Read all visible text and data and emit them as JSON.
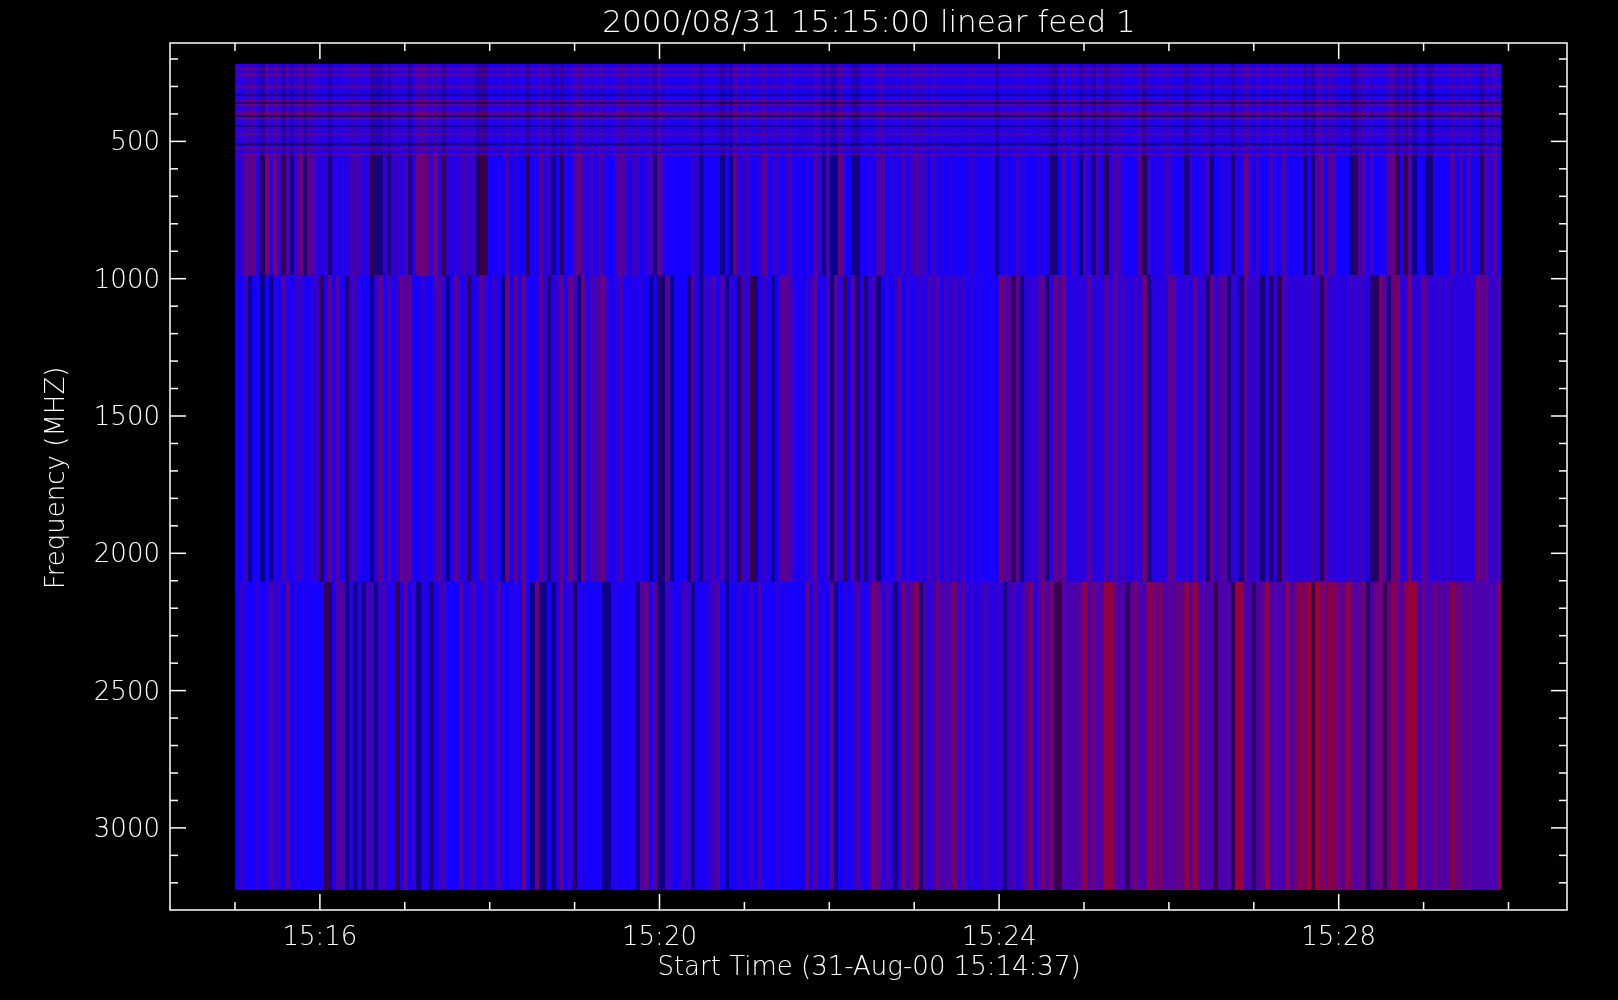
{
  "plot": {
    "title": "2000/08/31 15:15:00 linear feed 1",
    "x_axis": {
      "label": "Start Time (31-Aug-00 15:14:37)",
      "tick_labels": [
        "15:16",
        "15:20",
        "15:24",
        "15:28"
      ]
    },
    "y_axis": {
      "label": "Frequency (MHZ)",
      "tick_labels": [
        "500",
        "1000",
        "1500",
        "2000",
        "2500",
        "3000"
      ]
    }
  }
}
